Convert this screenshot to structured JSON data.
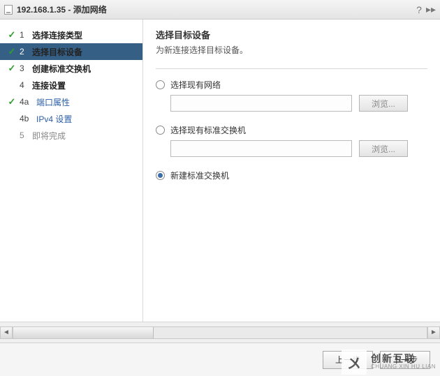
{
  "title": "192.168.1.35 - 添加网络",
  "sidebar": {
    "steps": [
      {
        "num": "1",
        "label": "选择连接类型",
        "checked": true,
        "active": false,
        "bold": true,
        "sub": false
      },
      {
        "num": "2",
        "label": "选择目标设备",
        "checked": true,
        "active": true,
        "bold": true,
        "sub": false
      },
      {
        "num": "3",
        "label": "创建标准交换机",
        "checked": true,
        "active": false,
        "bold": true,
        "sub": false
      },
      {
        "num": "4",
        "label": "连接设置",
        "checked": false,
        "active": false,
        "bold": true,
        "sub": false
      },
      {
        "num": "4a",
        "label": "端口属性",
        "checked": true,
        "active": false,
        "bold": false,
        "sub": true
      },
      {
        "num": "4b",
        "label": "IPv4 设置",
        "checked": false,
        "active": false,
        "bold": false,
        "sub": true
      },
      {
        "num": "5",
        "label": "即将完成",
        "checked": false,
        "active": false,
        "bold": false,
        "sub": false,
        "pending": true
      }
    ]
  },
  "content": {
    "heading": "选择目标设备",
    "subheading": "为新连接选择目标设备。",
    "options": [
      {
        "label": "选择现有网络",
        "checked": false,
        "input": true,
        "browse": "浏览..."
      },
      {
        "label": "选择现有标准交换机",
        "checked": false,
        "input": true,
        "browse": "浏览..."
      },
      {
        "label": "新建标准交换机",
        "checked": true,
        "input": false
      }
    ]
  },
  "footer": {
    "back": "上一步",
    "next": "下一步"
  },
  "watermark": {
    "cn": "创新互联",
    "en": "CHUANG XIN HU LIAN"
  }
}
